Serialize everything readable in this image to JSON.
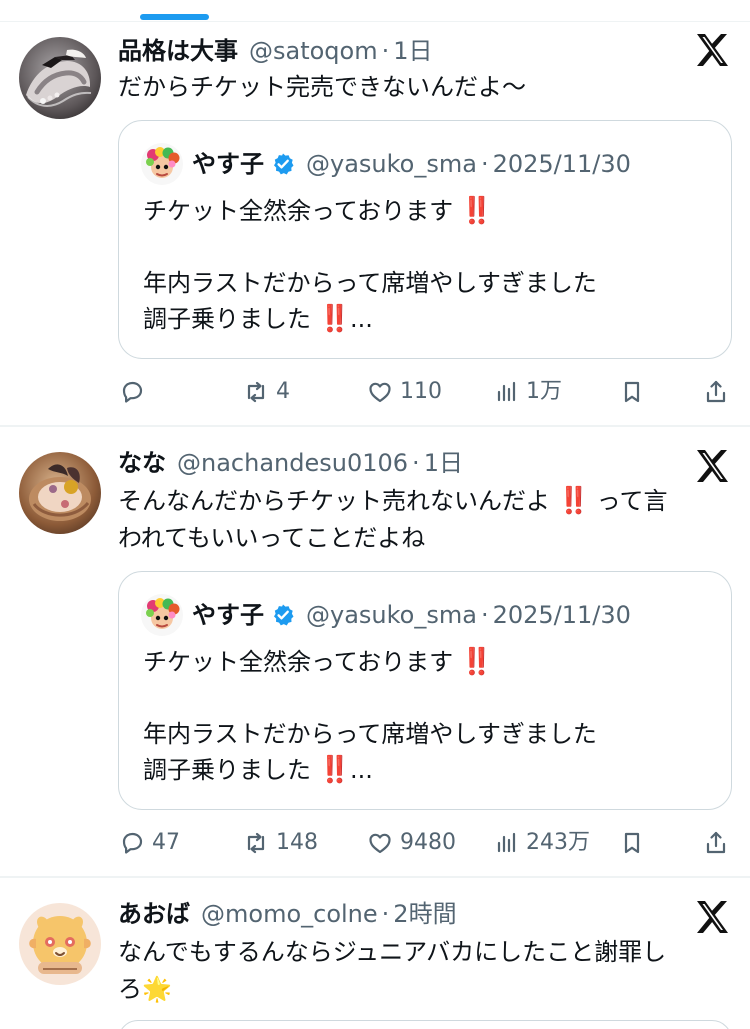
{
  "colors": {
    "accent": "#1d9bf0",
    "text": "#0f1419",
    "muted": "#536471",
    "border": "#cfd9de",
    "divider": "#eff3f4",
    "alert_red": "#e0241b"
  },
  "icons": {
    "x_logo": "x-logo-icon",
    "reply": "reply-icon",
    "repost": "repost-icon",
    "like": "heart-icon",
    "views": "views-icon",
    "bookmark": "bookmark-icon",
    "share": "share-icon",
    "verified": "verified-badge-icon"
  },
  "posts": [
    {
      "display_name": "品格は大事",
      "handle": "@satoqom",
      "separator": "·",
      "time": "1日",
      "text": "だからチケット完売できないんだよ〜",
      "quote": {
        "display_name": "やす子",
        "handle": "@yasuko_sma",
        "separator": "·",
        "time": "2025/11/30",
        "line1_text": "チケット全然余っております",
        "line1_emoji": "‼️",
        "line2_text": "年内ラストだからって席増やしすぎました",
        "line3_text": "調子乗りました",
        "line3_emoji": "‼️",
        "line3_ellipsis": "..."
      },
      "metrics": {
        "replies": "",
        "reposts": "4",
        "likes": "110",
        "views": "1万"
      }
    },
    {
      "display_name": "なな",
      "handle": "@nachandesu0106",
      "separator": "·",
      "time": "1日",
      "text_line1_before": "そんなんだからチケット売れないんだよ",
      "text_line1_emoji": "‼️",
      "text_line1_after": "って言",
      "text_line2": "われてもいいってことだよね",
      "quote": {
        "display_name": "やす子",
        "handle": "@yasuko_sma",
        "separator": "·",
        "time": "2025/11/30",
        "line1_text": "チケット全然余っております",
        "line1_emoji": "‼️",
        "line2_text": "年内ラストだからって席増やしすぎました",
        "line3_text": "調子乗りました",
        "line3_emoji": "‼️",
        "line3_ellipsis": "..."
      },
      "metrics": {
        "replies": "47",
        "reposts": "148",
        "likes": "9480",
        "views": "243万"
      }
    },
    {
      "display_name": "あおば",
      "handle": "@momo_colne",
      "separator": "·",
      "time": "2時間",
      "text_line1": "なんでもするんならジュニアバカにしたこと謝罪し",
      "text_line2": "ろ",
      "text_line2_emoji": "🌟"
    }
  ]
}
